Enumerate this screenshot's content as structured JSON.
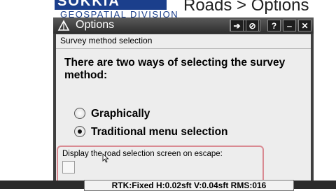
{
  "banner": {
    "logo_text": "SOKKIA",
    "logo_subtitle": "GEOSPATIAL DIVISION",
    "slide_title": "Roads > Options"
  },
  "window": {
    "title": "Options",
    "buttons": {
      "enter": "➔",
      "cancel": "⊘",
      "help": "?",
      "minimize": "‒",
      "close": "✕"
    }
  },
  "survey_section": {
    "label": "Survey method selection",
    "question": "There are two ways of selecting the survey method:",
    "options": [
      {
        "label": "Graphically",
        "selected": false
      },
      {
        "label": "Traditional menu selection",
        "selected": true
      }
    ]
  },
  "escape_option": {
    "label": "Display the road selection screen on escape:",
    "checked": false
  },
  "status_bar": {
    "text": "RTK:Fixed H:0.02sft V:0.04sft RMS:016"
  },
  "colors": {
    "highlight_border": "#d98a92",
    "title_bar": "#3f3f3f",
    "brand_blue": "#1b3f8c"
  }
}
